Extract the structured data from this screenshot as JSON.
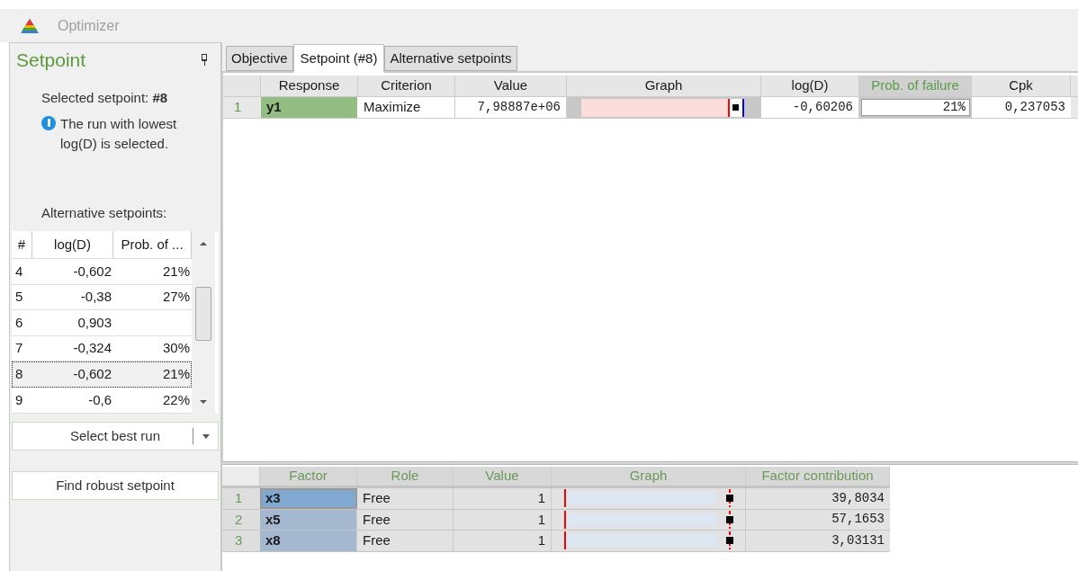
{
  "window": {
    "title": "Optimizer"
  },
  "panel": {
    "title": "Setpoint",
    "selected_label": "Selected setpoint:",
    "selected_value": "#8",
    "info": "The run with lowest log(D) is selected.",
    "alternatives_label": "Alternative setpoints:",
    "alternatives": {
      "columns": [
        "#",
        "log(D)",
        "Prob. of ..."
      ],
      "rows": [
        {
          "cells": [
            "4",
            "-0,602",
            "21%"
          ],
          "selected": false
        },
        {
          "cells": [
            "5",
            "-0,38",
            "27%"
          ],
          "selected": false
        },
        {
          "cells": [
            "6",
            "0,903",
            ""
          ],
          "selected": false
        },
        {
          "cells": [
            "7",
            "-0,324",
            "30%"
          ],
          "selected": false
        },
        {
          "cells": [
            "8",
            "-0,602",
            "21%"
          ],
          "selected": true
        },
        {
          "cells": [
            "9",
            "-0,6",
            "22%"
          ],
          "selected": false
        }
      ]
    },
    "select_button": "Select best run",
    "robust_button": "Find robust setpoint"
  },
  "tabs": [
    {
      "label": "Objective",
      "selected": false
    },
    {
      "label": "Setpoint (#8)",
      "selected": true
    },
    {
      "label": "Alternative setpoints",
      "selected": false
    }
  ],
  "responses": {
    "columns": [
      "Response",
      "Criterion",
      "Value",
      "Graph",
      "log(D)",
      "Prob. of failure",
      "Cpk"
    ],
    "rows": [
      {
        "index": "1",
        "response": "y1",
        "criterion": "Maximize",
        "value": "7,98887e+06",
        "logd": "-0,60206",
        "prob": "21%",
        "cpk": "0,237053"
      }
    ]
  },
  "factors": {
    "columns": [
      "Factor",
      "Role",
      "Value",
      "Graph",
      "Factor contribution"
    ],
    "rows": [
      {
        "index": "1",
        "factor": "x3",
        "role": "Free",
        "value": "1",
        "contribution": "39,8034",
        "selected": true
      },
      {
        "index": "2",
        "factor": "x5",
        "role": "Free",
        "value": "1",
        "contribution": "57,1653",
        "selected": false
      },
      {
        "index": "3",
        "factor": "x8",
        "role": "Free",
        "value": "1",
        "contribution": "3,03131",
        "selected": false
      }
    ]
  }
}
